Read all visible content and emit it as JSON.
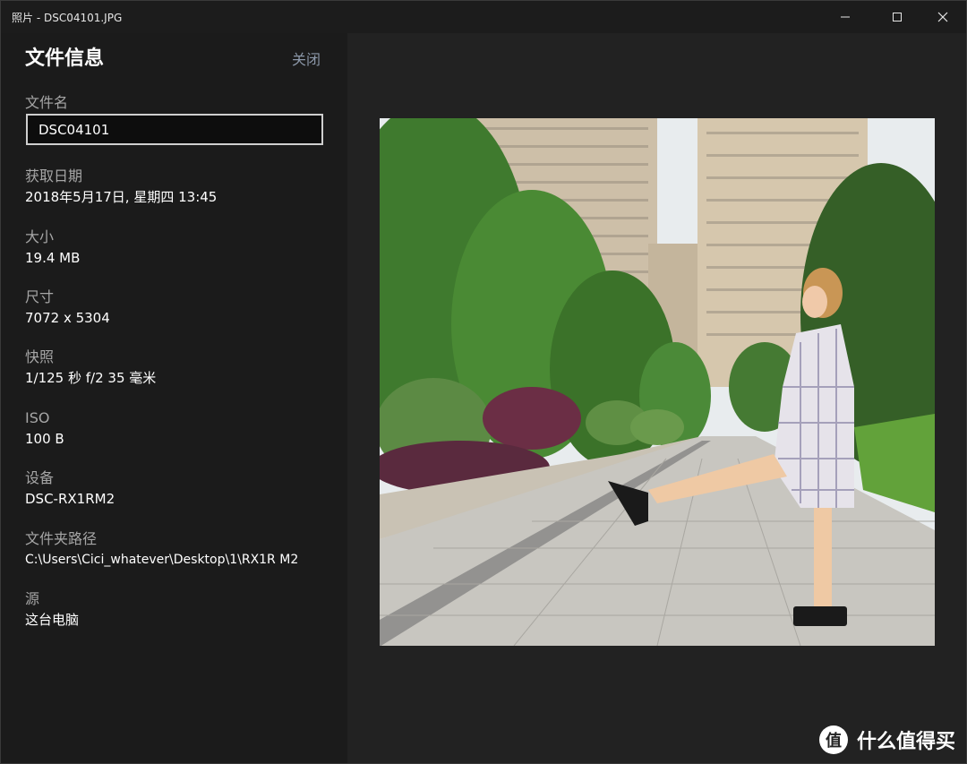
{
  "window": {
    "title": "照片 - DSC04101.JPG"
  },
  "panel": {
    "title": "文件信息",
    "close_label": "关闭",
    "filename": {
      "label": "文件名",
      "value": "DSC04101"
    },
    "date": {
      "label": "获取日期",
      "value": "2018年5月17日, 星期四 13:45"
    },
    "size": {
      "label": "大小",
      "value": "19.4 MB"
    },
    "dimensions": {
      "label": "尺寸",
      "value": "7072 x 5304"
    },
    "shot": {
      "label": "快照",
      "value": "1/125 秒 f/2 35 毫米"
    },
    "iso": {
      "label": "ISO",
      "value": "100 B"
    },
    "device": {
      "label": "设备",
      "value": "DSC-RX1RM2"
    },
    "folder": {
      "label": "文件夹路径",
      "value": "C:\\Users\\Cici_whatever\\Desktop\\1\\RX1R M2"
    },
    "source": {
      "label": "源",
      "value": "这台电脑"
    }
  },
  "watermark": {
    "logo": "值",
    "text": "什么值得买"
  }
}
